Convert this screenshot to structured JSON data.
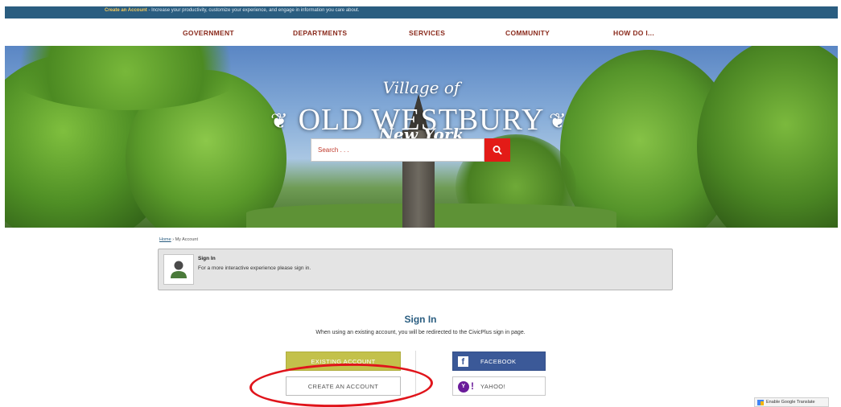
{
  "topbar": {
    "link": "Create an Account",
    "text": " - Increase your productivity, customize your experience, and engage in information you care about."
  },
  "nav": {
    "items": [
      "GOVERNMENT",
      "DEPARTMENTS",
      "SERVICES",
      "COMMUNITY",
      "HOW DO I..."
    ]
  },
  "hero": {
    "line1": "Village of",
    "line2": "OLD WESTBURY",
    "line3": "New York",
    "flourish_left": "❦",
    "flourish_right": "❦"
  },
  "search": {
    "placeholder": "Search . . .",
    "icon": "search-icon"
  },
  "breadcrumb": {
    "home": "Home",
    "separator": "›",
    "current": "My Account"
  },
  "signin_card": {
    "title": "Sign In",
    "subtitle": "For a more interactive experience please sign in.",
    "icon": "user-avatar-icon"
  },
  "signin": {
    "heading": "Sign In",
    "description": "When using an existing account, you will be redirected to the CivicPlus sign in page."
  },
  "buttons": {
    "existing": "EXISTING ACCOUNT",
    "create": "CREATE AN ACCOUNT",
    "facebook": "FACEBOOK",
    "yahoo": "YAHOO!"
  },
  "icons": {
    "facebook_glyph": "f",
    "yahoo_glyph": "Y",
    "yahoo_exclamation": "!"
  },
  "translate": {
    "label": "Enable Google Translate"
  },
  "colors": {
    "topbar": "#2a5d80",
    "nav_text": "#8a2a1c",
    "search_button": "#e31b17",
    "heading_blue": "#2a5d80",
    "existing_button": "#c3c14b",
    "facebook": "#3b5998",
    "yahoo": "#6a1b9a",
    "annotation_circle": "#e0141b"
  }
}
